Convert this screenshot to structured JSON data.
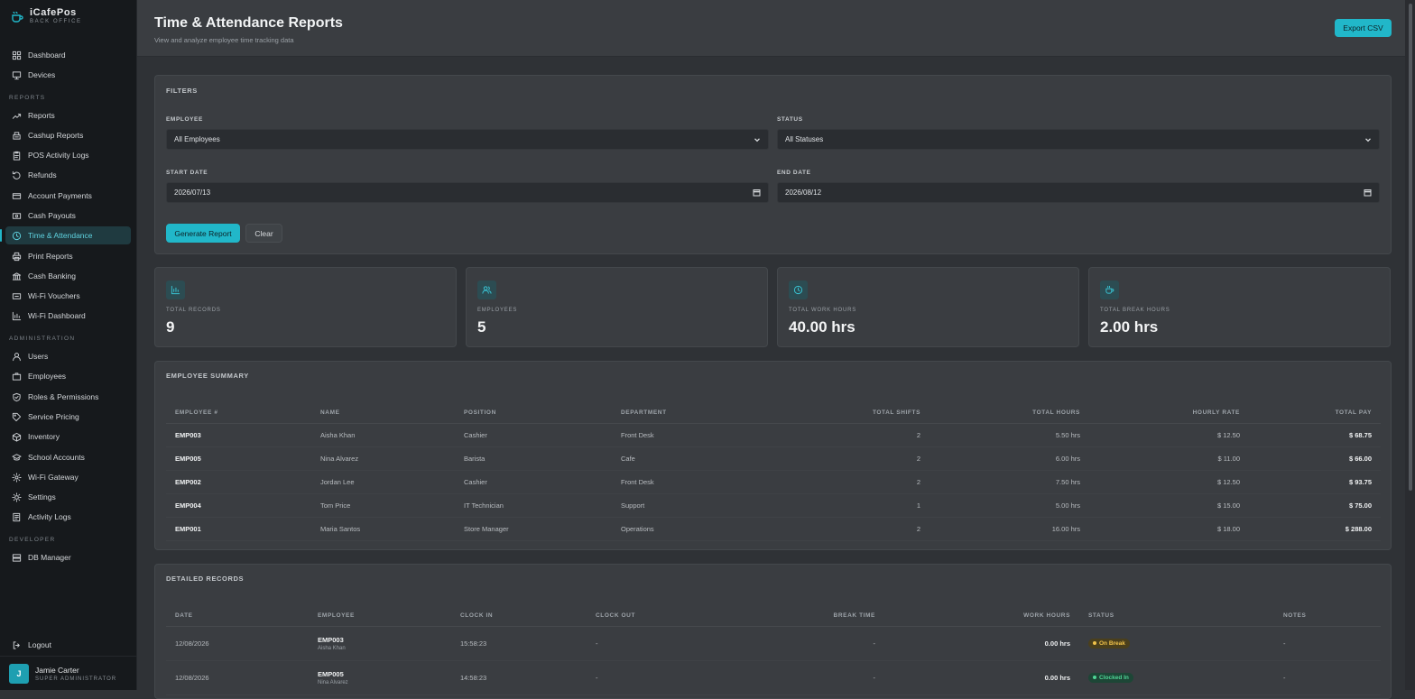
{
  "brand": {
    "title": "iCafePos",
    "subtitle": "BACK OFFICE"
  },
  "sidebar": {
    "top_items": [
      {
        "label": "Dashboard",
        "icon": "grid-icon"
      },
      {
        "label": "Devices",
        "icon": "monitor-icon"
      }
    ],
    "sections": [
      {
        "label": "REPORTS",
        "items": [
          {
            "label": "Reports",
            "icon": "trend-icon"
          },
          {
            "label": "Cashup Reports",
            "icon": "register-icon"
          },
          {
            "label": "POS Activity Logs",
            "icon": "clipboard-icon"
          },
          {
            "label": "Refunds",
            "icon": "undo-icon"
          },
          {
            "label": "Account Payments",
            "icon": "card-icon"
          },
          {
            "label": "Cash Payouts",
            "icon": "cash-icon"
          },
          {
            "label": "Time & Attendance",
            "icon": "clock-icon",
            "active": true
          },
          {
            "label": "Print Reports",
            "icon": "printer-icon"
          },
          {
            "label": "Cash Banking",
            "icon": "bank-icon"
          },
          {
            "label": "Wi-Fi Vouchers",
            "icon": "ticket-icon"
          },
          {
            "label": "Wi-Fi Dashboard",
            "icon": "bar-chart-icon"
          }
        ]
      },
      {
        "label": "ADMINISTRATION",
        "items": [
          {
            "label": "Users",
            "icon": "user-icon"
          },
          {
            "label": "Employees",
            "icon": "briefcase-icon"
          },
          {
            "label": "Roles & Permissions",
            "icon": "shield-icon"
          },
          {
            "label": "Service Pricing",
            "icon": "tag-icon"
          },
          {
            "label": "Inventory",
            "icon": "box-icon"
          },
          {
            "label": "School Accounts",
            "icon": "graduation-icon"
          },
          {
            "label": "Wi-Fi Gateway",
            "icon": "gear-icon"
          },
          {
            "label": "Settings",
            "icon": "settings-icon"
          },
          {
            "label": "Activity Logs",
            "icon": "list-icon"
          }
        ]
      },
      {
        "label": "DEVELOPER",
        "items": [
          {
            "label": "DB Manager",
            "icon": "database-icon"
          }
        ]
      }
    ],
    "logout": "Logout",
    "user": {
      "initial": "J",
      "name": "Jamie Carter",
      "role": "SUPER ADMINISTRATOR"
    }
  },
  "header": {
    "title": "Time & Attendance Reports",
    "subtitle": "View and analyze employee time tracking data",
    "export_label": "Export CSV"
  },
  "filters": {
    "title": "FILTERS",
    "employee_label": "EMPLOYEE",
    "employee_value": "All Employees",
    "status_label": "STATUS",
    "status_value": "All Statuses",
    "start_label": "START DATE",
    "start_value": "2026/07/13",
    "end_label": "END DATE",
    "end_value": "2026/08/12",
    "generate_label": "Generate Report",
    "clear_label": "Clear"
  },
  "stats": [
    {
      "label": "TOTAL RECORDS",
      "value": "9",
      "icon": "bar-chart-icon"
    },
    {
      "label": "EMPLOYEES",
      "value": "5",
      "icon": "users-icon"
    },
    {
      "label": "TOTAL WORK HOURS",
      "value": "40.00 hrs",
      "icon": "clock-icon"
    },
    {
      "label": "TOTAL BREAK HOURS",
      "value": "2.00 hrs",
      "icon": "coffee-icon"
    }
  ],
  "summary": {
    "title": "EMPLOYEE SUMMARY",
    "columns": [
      "EMPLOYEE #",
      "NAME",
      "POSITION",
      "DEPARTMENT",
      "TOTAL SHIFTS",
      "TOTAL HOURS",
      "HOURLY RATE",
      "TOTAL PAY"
    ],
    "rows": [
      [
        "EMP003",
        "Aisha Khan",
        "Cashier",
        "Front Desk",
        "2",
        "5.50 hrs",
        "$ 12.50",
        "$ 68.75"
      ],
      [
        "EMP005",
        "Nina Alvarez",
        "Barista",
        "Cafe",
        "2",
        "6.00 hrs",
        "$ 11.00",
        "$ 66.00"
      ],
      [
        "EMP002",
        "Jordan Lee",
        "Cashier",
        "Front Desk",
        "2",
        "7.50 hrs",
        "$ 12.50",
        "$ 93.75"
      ],
      [
        "EMP004",
        "Tom Price",
        "IT Technician",
        "Support",
        "1",
        "5.00 hrs",
        "$ 15.00",
        "$ 75.00"
      ],
      [
        "EMP001",
        "Maria Santos",
        "Store Manager",
        "Operations",
        "2",
        "16.00 hrs",
        "$ 18.00",
        "$ 288.00"
      ]
    ]
  },
  "detailed": {
    "title": "DETAILED RECORDS",
    "columns": [
      "DATE",
      "EMPLOYEE",
      "CLOCK IN",
      "CLOCK OUT",
      "BREAK TIME",
      "WORK HOURS",
      "STATUS",
      "NOTES"
    ],
    "rows": [
      {
        "date": "12/08/2026",
        "emp": "EMP003",
        "name": "Aisha Khan",
        "clock_in": "15:58:23",
        "clock_out": "-",
        "break": "-",
        "hours": "0.00 hrs",
        "status": "On Break",
        "status_type": "break",
        "notes": "-"
      },
      {
        "date": "12/08/2026",
        "emp": "EMP005",
        "name": "Nina Alvarez",
        "clock_in": "14:58:23",
        "clock_out": "-",
        "break": "-",
        "hours": "0.00 hrs",
        "status": "Clocked In",
        "status_type": "in",
        "notes": "-"
      }
    ]
  },
  "colors": {
    "accent": "#21b7c9",
    "sidebar_bg": "#16191c",
    "panel_bg": "#3a3d41",
    "on_break": "#f0c24a",
    "clocked_in": "#4fd596"
  }
}
